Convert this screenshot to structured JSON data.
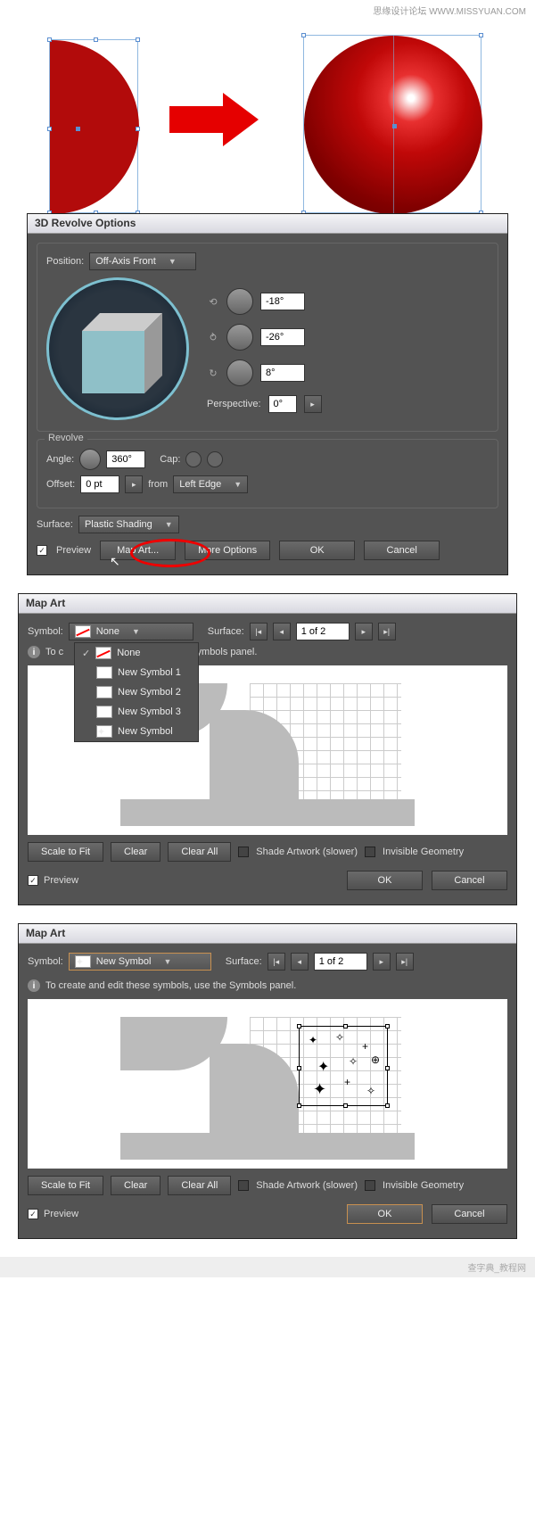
{
  "watermark_top": "思缘设计论坛  WWW.MISSYUAN.COM",
  "watermark_bottom": "查字典_教程网",
  "dialog1": {
    "title": "3D Revolve Options",
    "position_label": "Position:",
    "position_value": "Off-Axis Front",
    "rot_x": "-18°",
    "rot_y": "-26°",
    "rot_z": "8°",
    "perspective_label": "Perspective:",
    "perspective_value": "0°",
    "revolve_title": "Revolve",
    "angle_label": "Angle:",
    "angle_value": "360°",
    "cap_label": "Cap:",
    "offset_label": "Offset:",
    "offset_value": "0 pt",
    "from_label": "from",
    "from_value": "Left Edge",
    "surface_label": "Surface:",
    "surface_value": "Plastic Shading",
    "preview": "Preview",
    "map_art": "Map Art...",
    "more_options": "More Options",
    "ok": "OK",
    "cancel": "Cancel"
  },
  "dialog2": {
    "title": "Map Art",
    "symbol_label": "Symbol:",
    "symbol_value": "None",
    "surface_label": "Surface:",
    "surface_value": "1 of 2",
    "dropdown_items": [
      "None",
      "New Symbol 1",
      "New Symbol 2",
      "New Symbol 3",
      "New Symbol"
    ],
    "hint_partial": "To c",
    "hint_rest": "Symbols panel.",
    "scale_fit": "Scale to Fit",
    "clear": "Clear",
    "clear_all": "Clear All",
    "shade": "Shade Artwork (slower)",
    "invisible": "Invisible Geometry",
    "preview": "Preview",
    "ok": "OK",
    "cancel": "Cancel"
  },
  "dialog3": {
    "title": "Map Art",
    "symbol_label": "Symbol:",
    "symbol_value": "New Symbol",
    "surface_label": "Surface:",
    "surface_value": "1 of 2",
    "hint_full": "To create and edit these symbols, use the Symbols panel.",
    "scale_fit": "Scale to Fit",
    "clear": "Clear",
    "clear_all": "Clear All",
    "shade": "Shade Artwork (slower)",
    "invisible": "Invisible Geometry",
    "preview": "Preview",
    "ok": "OK",
    "cancel": "Cancel"
  }
}
